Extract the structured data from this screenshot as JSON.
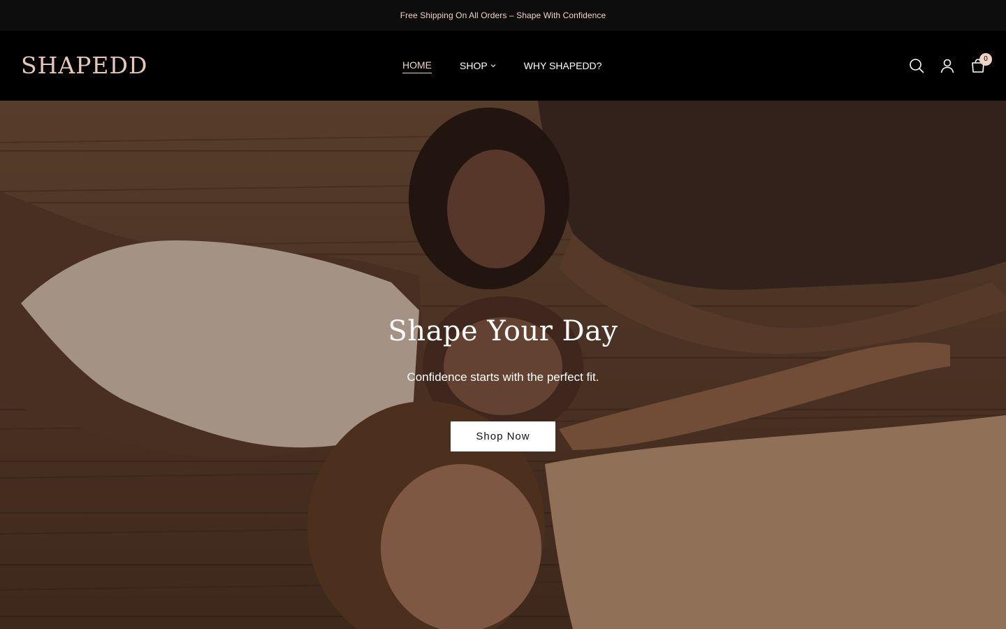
{
  "announcement": {
    "text": "Free Shipping On All Orders – Shape With Confidence"
  },
  "header": {
    "logo": "SHAPEDD",
    "nav": [
      {
        "label": "HOME",
        "active": true
      },
      {
        "label": "SHOP",
        "has_dropdown": true
      },
      {
        "label": "WHY SHAPEDD?"
      }
    ],
    "icons": [
      "search-icon",
      "account-icon",
      "cart-icon"
    ],
    "cart_count": "0"
  },
  "hero": {
    "title": "Shape Your Day",
    "subtitle": "Confidence starts with the perfect fit.",
    "cta_label": "Shop Now"
  },
  "colors": {
    "announcement_bg": "#0d0d0d",
    "header_bg": "#000000",
    "accent": "#f1d3c5",
    "button_bg": "#ffffff"
  }
}
